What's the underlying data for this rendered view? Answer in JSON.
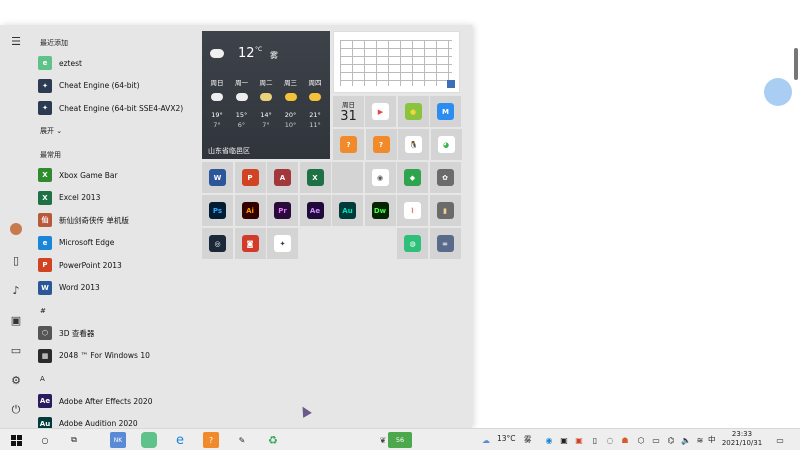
{
  "applist": {
    "recent_header": "最近添加",
    "recent": [
      {
        "label": "eztest",
        "icon": "eztest-icon",
        "color": "#5ec28a",
        "glyph": "e"
      },
      {
        "label": "Cheat Engine (64-bit)",
        "icon": "cheat-engine-icon",
        "color": "#2c3a52",
        "glyph": "✦"
      },
      {
        "label": "Cheat Engine (64-bit SSE4-AVX2)",
        "icon": "cheat-engine-icon",
        "color": "#2c3a52",
        "glyph": "✦"
      }
    ],
    "expand_label": "展开",
    "frequent_header": "最常用",
    "frequent": [
      {
        "label": "Xbox Game Bar",
        "icon": "xbox-game-bar-icon",
        "color": "#2e8b2e",
        "glyph": "X"
      },
      {
        "label": "Excel 2013",
        "icon": "excel-icon",
        "color": "#1e7145",
        "glyph": "X"
      },
      {
        "label": "新仙剑奇侠传 单机版",
        "icon": "game-icon",
        "color": "#b85a3a",
        "glyph": "仙"
      },
      {
        "label": "Microsoft Edge",
        "icon": "edge-icon",
        "color": "#1a86d8",
        "glyph": "e"
      },
      {
        "label": "PowerPoint 2013",
        "icon": "powerpoint-icon",
        "color": "#d04423",
        "glyph": "P"
      },
      {
        "label": "Word 2013",
        "icon": "word-icon",
        "color": "#2b579a",
        "glyph": "W"
      }
    ],
    "hash_header": "#",
    "hash": [
      {
        "label": "3D 查看器",
        "icon": "3d-viewer-icon",
        "color": "#555555",
        "glyph": "⬡"
      },
      {
        "label": "2048 ™ For Windows 10",
        "icon": "2048-icon",
        "color": "#2b2b2b",
        "glyph": "▦"
      }
    ],
    "a_header": "A",
    "a": [
      {
        "label": "Adobe After Effects 2020",
        "icon": "after-effects-icon",
        "color": "#2a1a5e",
        "glyph": "Ae"
      },
      {
        "label": "Adobe Audition 2020",
        "icon": "audition-icon",
        "color": "#003a3a",
        "glyph": "Au"
      }
    ]
  },
  "weather": {
    "temp": "12",
    "unit": "°C",
    "condition": "雾",
    "location": "山东省临邑区",
    "days": [
      {
        "day": "周日",
        "hi": "19°",
        "lo": "7°",
        "icon": "cloud-icon",
        "color": "#eeeeee"
      },
      {
        "day": "周一",
        "hi": "15°",
        "lo": "6°",
        "icon": "cloud-icon",
        "color": "#eeeeee"
      },
      {
        "day": "周二",
        "hi": "14°",
        "lo": "7°",
        "icon": "partly-cloudy-icon",
        "color": "#e9d27a"
      },
      {
        "day": "周三",
        "hi": "20°",
        "lo": "10°",
        "icon": "sun-icon",
        "color": "#f3c23a"
      },
      {
        "day": "周四",
        "hi": "21°",
        "lo": "11°",
        "icon": "sun-icon",
        "color": "#f3c23a"
      }
    ]
  },
  "calendar": {
    "day": "周日",
    "num": "31"
  },
  "tiles": {
    "row1": [
      {
        "name": "play-store-icon",
        "color": "#ffffff",
        "glyph": "▶",
        "fg": "#e8453c"
      },
      {
        "name": "mango-icon",
        "color": "#8ac43f",
        "glyph": "●",
        "fg": "#f5d43a"
      },
      {
        "name": "maps-icon",
        "color": "#2d8cf0",
        "glyph": "M",
        "fg": "#ffffff"
      }
    ],
    "row2": [
      {
        "name": "game-app-icon",
        "color": "#f08a2a",
        "glyph": "?",
        "fg": "#ffffff"
      },
      {
        "name": "game-app-icon",
        "color": "#f08a2a",
        "glyph": "?",
        "fg": "#ffffff"
      },
      {
        "name": "qq-icon",
        "color": "#ffffff",
        "glyph": "🐧",
        "fg": "#000000"
      },
      {
        "name": "wechat-icon",
        "color": "#ffffff",
        "glyph": "◕",
        "fg": "#3bb34a"
      }
    ],
    "row3": [
      {
        "name": "word-icon",
        "color": "#2b579a",
        "glyph": "W",
        "fg": "#ffffff"
      },
      {
        "name": "powerpoint-icon",
        "color": "#d04423",
        "glyph": "P",
        "fg": "#ffffff"
      },
      {
        "name": "access-icon",
        "color": "#a4373a",
        "glyph": "A",
        "fg": "#ffffff"
      },
      {
        "name": "excel-icon",
        "color": "#1e7145",
        "glyph": "X",
        "fg": "#ffffff"
      },
      {
        "name": "empty-tile",
        "color": "#d4d4d4",
        "glyph": "",
        "fg": "#ffffff"
      },
      {
        "name": "camera-icon",
        "color": "#ffffff",
        "glyph": "◉",
        "fg": "#555555"
      },
      {
        "name": "green-app-icon",
        "color": "#2ea44f",
        "glyph": "◆",
        "fg": "#ffffff"
      },
      {
        "name": "settings-icon",
        "color": "#6b6b6b",
        "glyph": "✿",
        "fg": "#ffffff"
      }
    ],
    "row4": [
      {
        "name": "photoshop-icon",
        "color": "#001d34",
        "glyph": "Ps",
        "fg": "#31a8ff"
      },
      {
        "name": "illustrator-icon",
        "color": "#330000",
        "glyph": "Ai",
        "fg": "#ff9a00"
      },
      {
        "name": "premiere-icon",
        "color": "#2a0a3a",
        "glyph": "Pr",
        "fg": "#e579ff"
      },
      {
        "name": "after-effects-icon",
        "color": "#1f0a3a",
        "glyph": "Ae",
        "fg": "#d291ff"
      },
      {
        "name": "audition-icon",
        "color": "#003a3a",
        "glyph": "Au",
        "fg": "#00e4bb"
      },
      {
        "name": "dreamweaver-icon",
        "color": "#072401",
        "glyph": "Dw",
        "fg": "#4aff4a"
      },
      {
        "name": "bracket-app-icon",
        "color": "#ffffff",
        "glyph": "⌇",
        "fg": "#d65a2a"
      },
      {
        "name": "notes-icon",
        "color": "#6b6b6b",
        "glyph": "▮",
        "fg": "#f0d48a"
      }
    ],
    "row5": [
      {
        "name": "steam-icon",
        "color": "#1b2838",
        "glyph": "◎",
        "fg": "#ffffff"
      },
      {
        "name": "red-app-icon",
        "color": "#d23a2a",
        "glyph": "◙",
        "fg": "#ffffff"
      },
      {
        "name": "cheat-engine-icon",
        "color": "#ffffff",
        "glyph": "✦",
        "fg": "#2c3a52"
      },
      {
        "name": "green-circle-icon",
        "color": "#2ec07a",
        "glyph": "◍",
        "fg": "#ffffff"
      },
      {
        "name": "link-app-icon",
        "color": "#5a6a8a",
        "glyph": "∞",
        "fg": "#ffffff"
      }
    ]
  },
  "taskbar": {
    "weather_temp": "13°C",
    "weather_cond": "雾",
    "battery": "56",
    "ime": "中",
    "time": "23:33",
    "date": "2021/10/31"
  }
}
